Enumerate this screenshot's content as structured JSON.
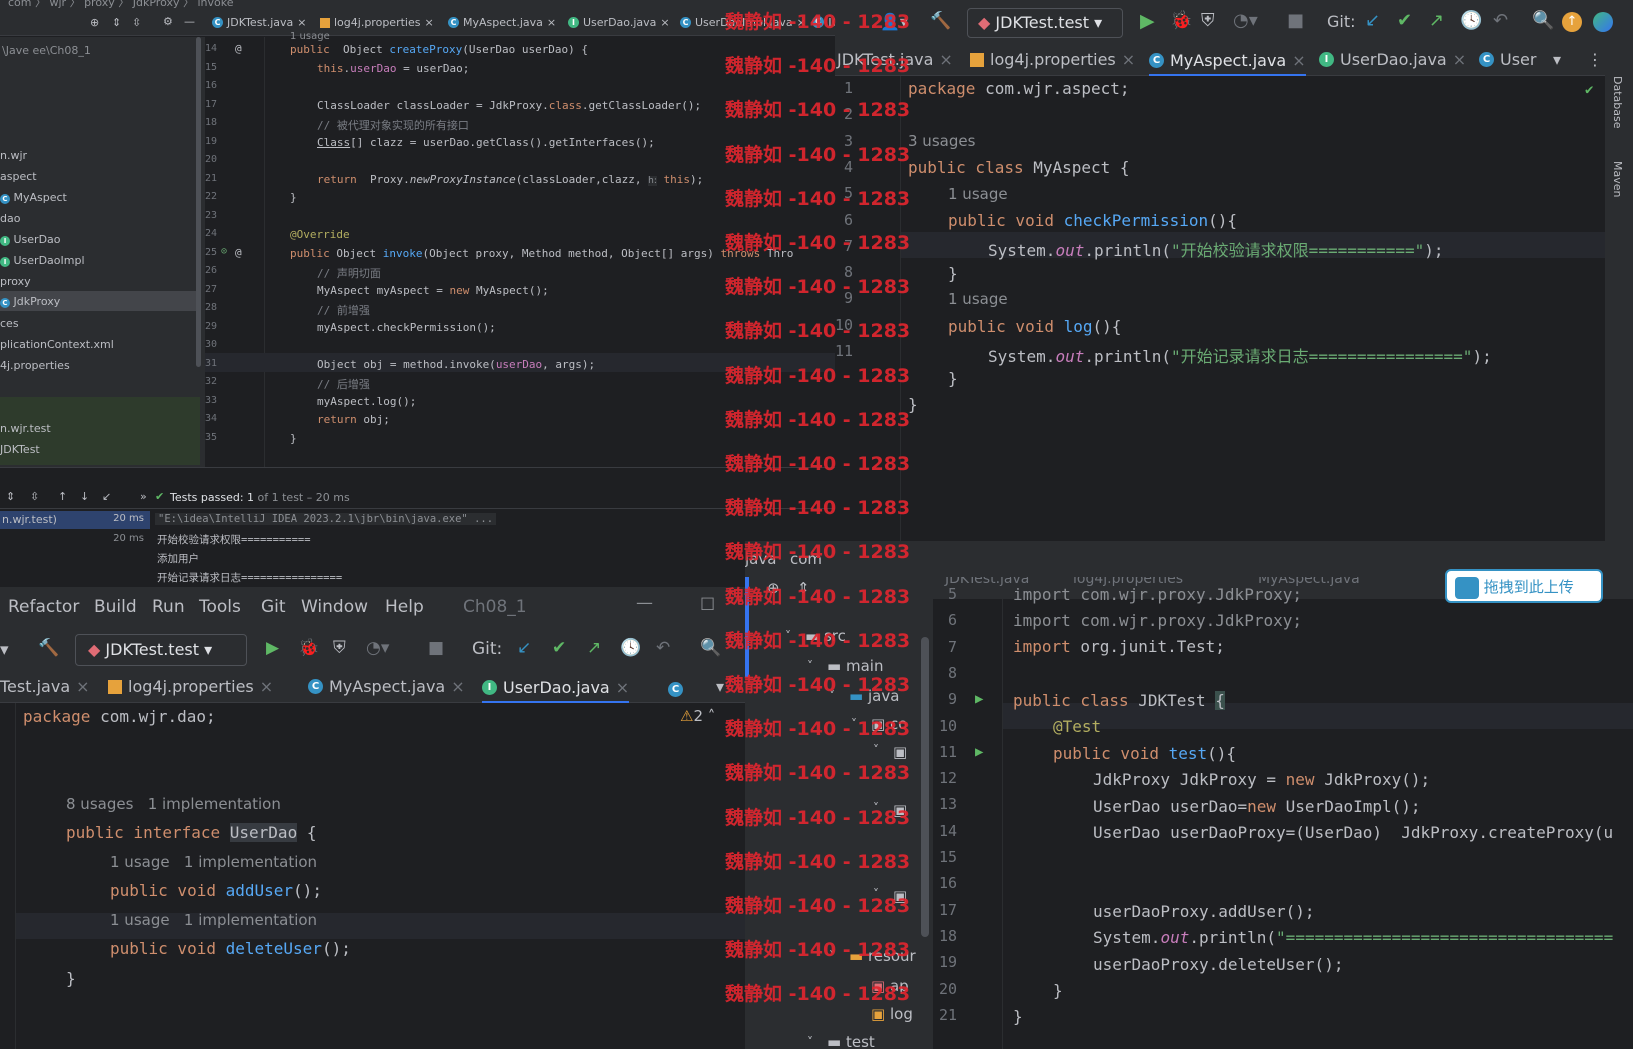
{
  "topWindow": {
    "breadcrumb": [
      "com",
      "wjr",
      "proxy",
      "JdkProxy",
      "invoke"
    ],
    "titleCut": "JDKTest.test",
    "tabs": [
      {
        "label": "JDKTest.java",
        "icon": "class-icon"
      },
      {
        "label": "log4j.properties",
        "icon": "properties-icon"
      },
      {
        "label": "MyAspect.java",
        "icon": "class-icon"
      },
      {
        "label": "UserDao.java",
        "icon": "interface-icon"
      },
      {
        "label": "UserDaoImpl.java",
        "icon": "interface-icon"
      },
      {
        "label": "ion",
        "icon": "class-icon"
      }
    ],
    "projectPath": "\\Jave ee\\Ch08_1",
    "tree": [
      "n.wjr",
      "aspect",
      "MyAspect",
      "dao",
      "UserDao",
      "UserDaoImpl",
      "proxy",
      "JdkProxy",
      "ces",
      "plicationContext.xml",
      "4j.properties",
      "n.wjr.test",
      "JDKTest"
    ],
    "code": {
      "lines": [
        "14",
        "15",
        "16",
        "17",
        "18",
        "19",
        "20",
        "21",
        "22",
        "23",
        "24",
        "25",
        "26",
        "27",
        "28",
        "29",
        "30",
        "31",
        "32",
        "33",
        "34",
        "35"
      ],
      "usageHint": "1 usage",
      "l14": "public  Object createProxy(UserDao userDao) {",
      "l15": "this.userDao = userDao;",
      "l17": "ClassLoader classLoader = JdkProxy.class.getClassLoader();",
      "l18": "// 被代理对象实现的所有接口",
      "l19": "Class[] clazz = userDao.getClass().getInterfaces();",
      "l21a": "return  Proxy.newProxyInstance(classLoader,clazz,",
      "l21h": "h:",
      "l21b": "this);",
      "l22": "}",
      "l24": "@Override",
      "l25": "public Object invoke(Object proxy, Method method, Object[] args) throws Thro",
      "l26": "// 声明切面",
      "l27": "MyAspect myAspect = new MyAspect();",
      "l28": "// 前增强",
      "l29": "myAspect.checkPermission();",
      "l31": "Object obj = method.invoke(userDao, args);",
      "l32": "// 后增强",
      "l33": "myAspect.log();",
      "l34": "return obj;",
      "l35": "}"
    },
    "run": {
      "status": "Tests passed: 1",
      "statusTail": " of 1 test – 20 ms",
      "rows": [
        {
          "name": "n.wjr.test)",
          "time": "20 ms"
        },
        {
          "name": "",
          "time": "20 ms"
        }
      ],
      "output": [
        "\"E:\\idea\\IntelliJ IDEA 2023.2.1\\jbr\\bin\\java.exe\" ...",
        "开始校验请求权限===========",
        "添加用户",
        "开始记录请求日志================"
      ]
    }
  },
  "rightWindow": {
    "runConfig": "JDKTest.test",
    "git": "Git:",
    "tabs": [
      {
        "label": "JDKTest.java",
        "icon": "class-icon"
      },
      {
        "label": "log4j.properties",
        "icon": "properties-icon"
      },
      {
        "label": "MyAspect.java",
        "icon": "class-icon"
      },
      {
        "label": "UserDao.java",
        "icon": "interface-icon"
      },
      {
        "label": "User",
        "icon": "class-icon"
      }
    ],
    "lines": [
      "1",
      "2",
      "3",
      "4",
      "5",
      "6",
      "7",
      "8",
      "9",
      "10",
      "11"
    ],
    "code": {
      "l1a": "package",
      "l1b": " com.wjr.aspect;",
      "u3": "3 usages",
      "l3a": "public class",
      "l3b": " MyAspect {",
      "u1": "1 usage",
      "l4a": "public void",
      "l4b": "checkPermission",
      "l4c": "(){",
      "l5a": "System.",
      "l5b": "out",
      "l5c": ".println(",
      "l5d": "\"开始校验请求权限===========\"",
      "l5e": ");",
      "l6": "}",
      "u2": "1 usage",
      "l7a": "public void",
      "l7b": "log",
      "l7c": "(){",
      "l8a": "System.",
      "l8b": "out",
      "l8c": ".println(",
      "l8d": "\"开始记录请求日志================\"",
      "l8e": ");",
      "l9": "}",
      "l10": "}"
    },
    "sidePanels": [
      "Database",
      "Maven"
    ]
  },
  "bottomLeftWindow": {
    "menu": [
      "Refactor",
      "Build",
      "Run",
      "Tools",
      "Git",
      "Window",
      "Help"
    ],
    "project": "Ch08_1",
    "runConfig": "JDKTest.test",
    "git": "Git:",
    "tabs": [
      {
        "label": "Test.java",
        "icon": "class-icon"
      },
      {
        "label": "log4j.properties",
        "icon": "properties-icon"
      },
      {
        "label": "MyAspect.java",
        "icon": "class-icon"
      },
      {
        "label": "UserDao.java",
        "icon": "interface-icon"
      }
    ],
    "warnings": "2",
    "code": {
      "l1a": "package",
      "l1b": " com.wjr.dao;",
      "usages": "8 usages",
      "impl": "1 implementation",
      "l2a": "public interface",
      "l2b": "UserDao",
      "l2c": " {",
      "u1": "1 usage",
      "i1": "1 implementation",
      "l3a": "public void",
      "l3b": "addUser",
      "l3c": "();",
      "u2": "1 usage",
      "i2": "1 implementation",
      "l4a": "public void",
      "l4b": "deleteUser",
      "l4c": "();",
      "l5": "}"
    }
  },
  "bottomRightWindow": {
    "breadcrumb": [
      "java",
      "com"
    ],
    "tree": [
      "src",
      "main",
      "java",
      "co",
      "resour",
      "ap",
      "log",
      "test"
    ],
    "tabs": [
      "JDKTest.java",
      "log4j.properties",
      "MyAspect.java"
    ],
    "upload": "拖拽到此上传",
    "lines": [
      "5",
      "6",
      "7",
      "8",
      "9",
      "10",
      "11",
      "12",
      "13",
      "14",
      "15",
      "16",
      "17",
      "18",
      "19",
      "20",
      "21"
    ],
    "code": {
      "l5": "import com.wjr.proxy.JdkProxy;",
      "l6a": "import",
      "l6b": " com.wjr.proxy.JdkProxy;",
      "l7a": "import",
      "l7b": " org.junit.Test;",
      "l9a": "public class",
      "l9b": " JDKTest ",
      "l9c": "{",
      "l10": "@Test",
      "l11a": "public void",
      "l11b": "test",
      "l11c": "(){",
      "l12a": "JdkProxy JdkProxy = ",
      "l12b": "new",
      "l12c": " JdkProxy();",
      "l13a": "UserDao userDao=",
      "l13b": "new",
      "l13c": " UserDaoImpl();",
      "l14": "UserDao userDaoProxy=(UserDao)  JdkProxy.createProxy(u",
      "l17": "userDaoProxy.addUser();",
      "l18a": "System.",
      "l18b": "out",
      "l18c": ".println(",
      "l18d": "\"==================================",
      "l19": "userDaoProxy.deleteUser();",
      "l20": "}",
      "l21": "}"
    }
  },
  "watermark": "魏静如 -140 - 1283"
}
